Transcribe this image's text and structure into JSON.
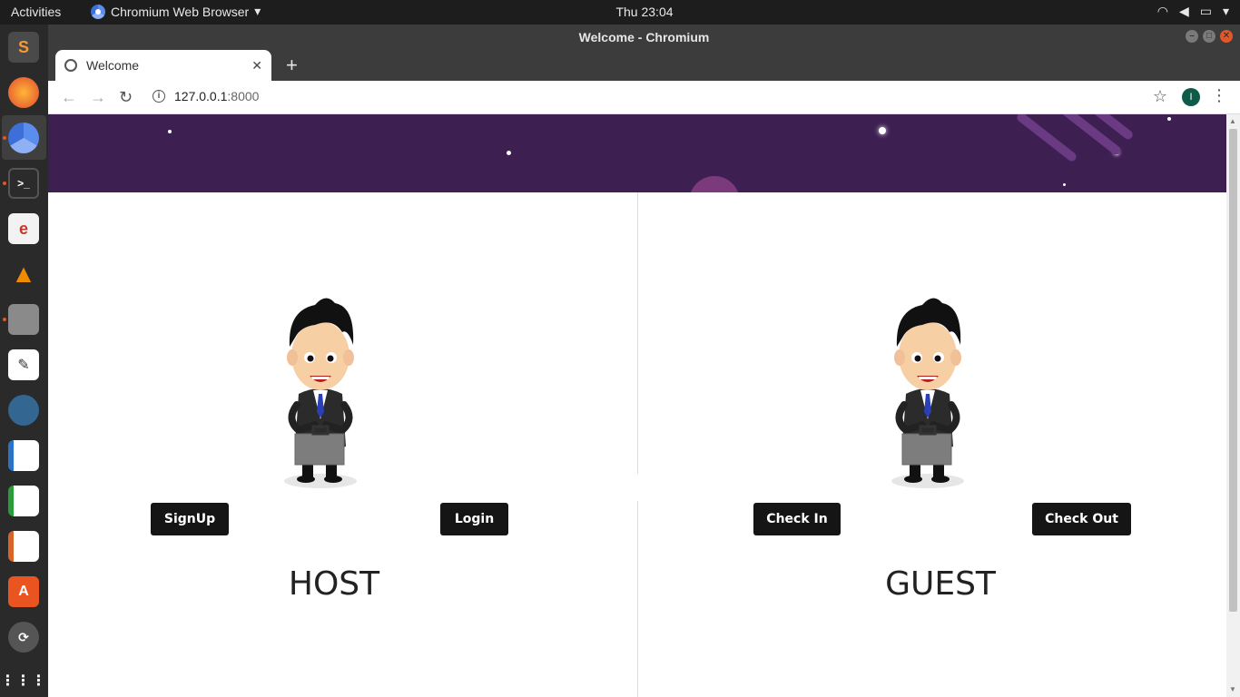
{
  "topbar": {
    "activities": "Activities",
    "app_name": "Chromium Web Browser",
    "clock": "Thu 23:04"
  },
  "dock": {
    "apps": [
      "sublime-text",
      "firefox",
      "chromium",
      "terminal",
      "document-viewer",
      "vlc",
      "files",
      "text-editor",
      "pgadmin",
      "libreoffice-writer",
      "libreoffice-calc",
      "libreoffice-impress",
      "software-center",
      "ubuntu-updater",
      "show-applications"
    ]
  },
  "window": {
    "title": "Welcome - Chromium",
    "tab_title": "Welcome",
    "url_host": "127.0.0.1",
    "url_port": ":8000",
    "profile_initial": "I"
  },
  "host": {
    "heading": "HOST",
    "signup_label": "SignUp",
    "login_label": "Login"
  },
  "guest": {
    "heading": "GUEST",
    "checkin_label": "Check In",
    "checkout_label": "Check Out"
  },
  "colors": {
    "hero_bg": "#3d1f52",
    "button_bg": "#151515",
    "accent": "#e95420"
  }
}
